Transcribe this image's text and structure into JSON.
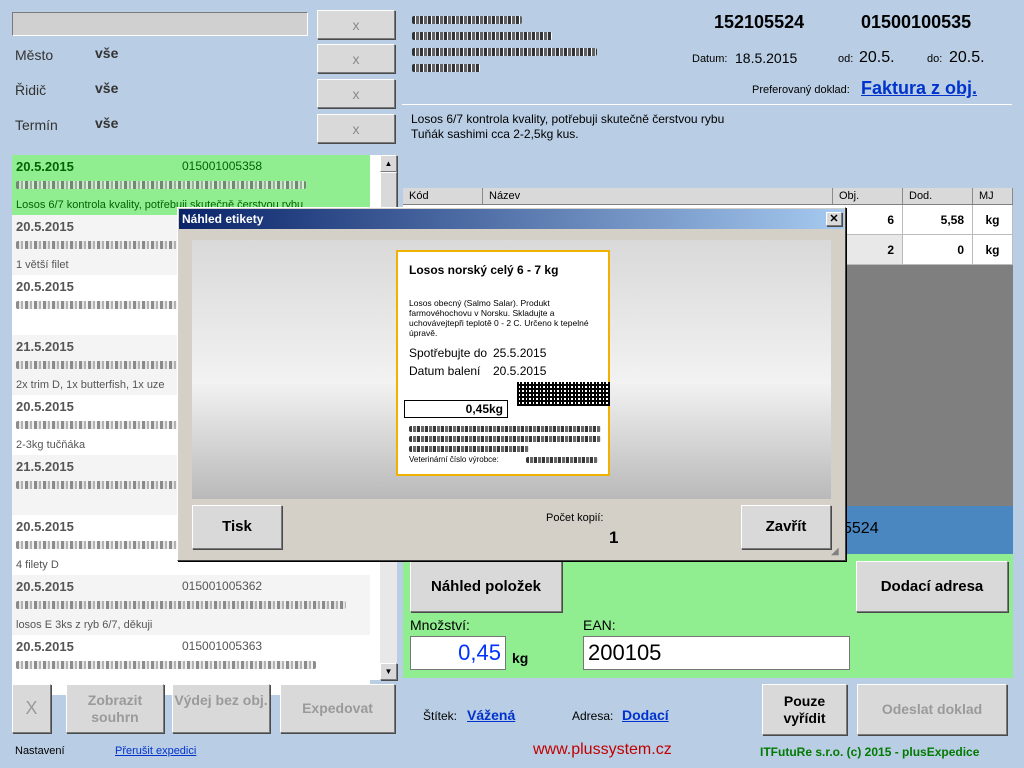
{
  "filters": {
    "search_value": "",
    "rows": [
      {
        "label": "Město",
        "value": "vše"
      },
      {
        "label": "Řidič",
        "value": "vše"
      },
      {
        "label": "Termín",
        "value": "vše"
      }
    ],
    "clear_label": "x"
  },
  "order_list": [
    {
      "date": "20.5.2015",
      "code": "015001005358",
      "note": "Losos 6/7 kontrola kvality, potřebuji skutečně čerstvou rybu",
      "selected": true
    },
    {
      "date": "20.5.2015",
      "code": "",
      "note": "1 větší filet",
      "selected": false
    },
    {
      "date": "20.5.2015",
      "code": "",
      "note": "",
      "selected": false
    },
    {
      "date": "21.5.2015",
      "code": "",
      "note": "2x trim D, 1x butterfish, 1x uze",
      "selected": false
    },
    {
      "date": "20.5.2015",
      "code": "",
      "note": "2-3kg tučňáka",
      "selected": false
    },
    {
      "date": "21.5.2015",
      "code": "",
      "note": "",
      "selected": false
    },
    {
      "date": "20.5.2015",
      "code": "",
      "note": "4 filety D",
      "selected": false
    },
    {
      "date": "20.5.2015",
      "code": "015001005362",
      "note": "losos E 3ks z ryb 6/7, děkuji",
      "selected": false
    },
    {
      "date": "20.5.2015",
      "code": "015001005363",
      "note": "",
      "selected": false
    }
  ],
  "header": {
    "order_number": "152105524",
    "customer_number": "01500100535",
    "date_label": "Datum:",
    "date_value": "18.5.2015",
    "from_label": "od:",
    "from_value": "20.5.",
    "to_label": "do:",
    "to_value": "20.5.",
    "pref_doc_label": "Preferovaný doklad:",
    "pref_doc_value": "Faktura z obj."
  },
  "order_note": {
    "line1": "Losos 6/7 kontrola kvality, potřebuji skutečně čerstvou rybu",
    "line2": "Tuňák sashimi cca 2-2,5kg kus."
  },
  "items_table": {
    "headers": [
      "Kód",
      "Název",
      "Obj.",
      "Dod.",
      "MJ"
    ],
    "rows": [
      {
        "obj": "6",
        "dod": "5,58",
        "mj": "kg"
      },
      {
        "obj": "2",
        "dod": "0",
        "mj": "kg"
      }
    ]
  },
  "barcode_strip": {
    "text": "5524"
  },
  "actions": {
    "preview_items": "Náhled položek",
    "delivery_address": "Dodací adresa",
    "quantity_label": "Množství:",
    "quantity_value": "0,45",
    "quantity_unit": "kg",
    "ean_label": "EAN:",
    "ean_value": "200105"
  },
  "bottom_left_buttons": {
    "x_label": "X",
    "summary": "Zobrazit souhrn",
    "issue_without_order": "Výdej bez obj.",
    "dispatch": "Expedovat"
  },
  "bottom_right": {
    "label_label": "Štítek:",
    "label_value": "Vážená",
    "address_label": "Adresa:",
    "address_value": "Dodací",
    "only_settle": "Pouze vyřídit",
    "send_doc": "Odeslat doklad"
  },
  "footer": {
    "settings": "Nastavení",
    "interrupt": "Přerušit expedici",
    "website": "www.plussystem.cz",
    "copyright": "ITFutuRe s.r.o. (c) 2015 - plusExpedice"
  },
  "dialog": {
    "title": "Náhled etikety",
    "print": "Tisk",
    "close": "Zavřít",
    "copies_label": "Počet kopií:",
    "copies_value": "1",
    "label": {
      "title": "Losos norský celý 6 - 7 kg",
      "description": "Losos obecný (Salmo Salar). Produkt farmovéhochovu v Norsku. Skladujte a uchovávejtepři teplotě 0 - 2 C. Určeno k tepelné úpravě.",
      "best_before_label": "Spotřebujte do",
      "best_before_value": "25.5.2015",
      "packed_label": "Datum balení",
      "packed_value": "20.5.2015",
      "weight": "0,45kg",
      "vet_label": "Veterinární číslo výrobce:"
    }
  },
  "colors": {
    "background": "#b9cde4",
    "green_panel": "#90ee90",
    "selected_row": "#90ee90",
    "link_blue": "#0033cc",
    "accent_blue": "#4a86c0",
    "website_red": "#c00000",
    "copyright_green": "#007a00"
  }
}
